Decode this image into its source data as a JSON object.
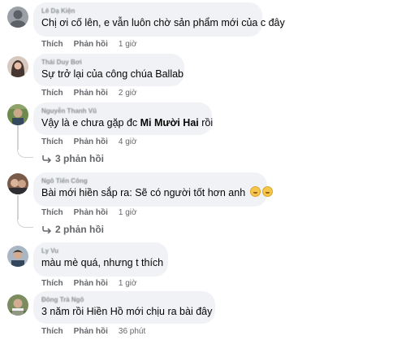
{
  "actions": {
    "like": "Thích",
    "reply": "Phản hồi"
  },
  "comments": [
    {
      "author": "Lê Dạ Kiện",
      "text": "Chị ơi cố lên, e vẫn luôn chờ sản phẩm mới của c đây",
      "time": "1 giờ",
      "avatar_color": "#6d6e74"
    },
    {
      "author": "Thái Duy Bơi",
      "text": "Sự trở lại của công chúa Ballab",
      "time": "2 giờ",
      "avatar_color": "#3b2a25"
    },
    {
      "author": "Nguyễn Thanh Vũ",
      "text_before": "Vậy là e chưa gặp đc ",
      "text_bold": "Mi Mười Hai",
      "text_after": " rồi",
      "time": "4 giờ",
      "replies": "3 phản hồi",
      "avatar_color": "#4f6a3a"
    },
    {
      "author": "Ngô Tiến Công",
      "text": "Bài mới hiền sắp ra: Sẽ có người tốt hơn anh",
      "time": "1 giờ",
      "replies": "2 phản hồi",
      "avatar_color": "#5a3b2e"
    },
    {
      "author": "Ly Vu",
      "text": "màu mè quá, nhưng t thích",
      "time": "1 giờ",
      "avatar_color": "#35465a"
    },
    {
      "author": "Đông Trà Ngô",
      "text": "3 năm rồi Hiền Hồ mới chịu ra bài đây",
      "time": "36 phút",
      "avatar_color": "#5d6b4a"
    }
  ]
}
